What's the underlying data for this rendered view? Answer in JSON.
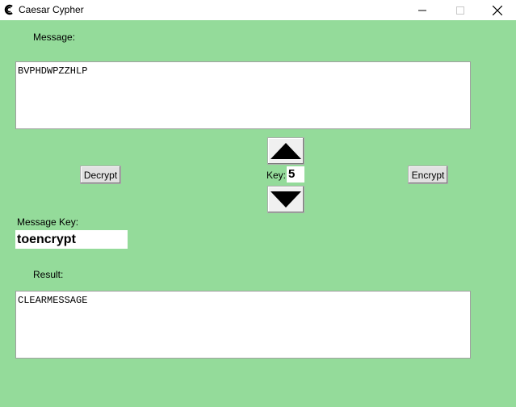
{
  "window": {
    "title": "Caesar Cypher",
    "icon": "caesar-c-icon"
  },
  "labels": {
    "message": "Message:",
    "key": "Key:",
    "message_key": "Message Key:",
    "result": "Result:"
  },
  "message_text": "BVPHDWPZZHLP",
  "key_value": "5",
  "message_key_value": "toencrypt",
  "result_text": "CLEARMESSAGE",
  "buttons": {
    "decrypt": "Decrypt",
    "encrypt": "Encrypt",
    "up": "up-arrow-icon",
    "down": "down-arrow-icon"
  },
  "colors": {
    "background": "#94db9a",
    "titlebar": "#ffffff"
  }
}
